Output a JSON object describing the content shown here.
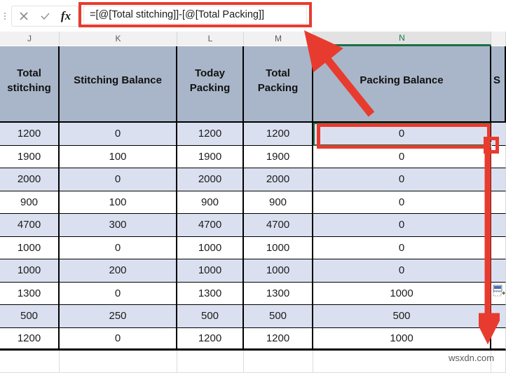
{
  "formula_bar": {
    "cancel_icon": "close-icon",
    "enter_icon": "check-icon",
    "fx_label": "fx",
    "formula": "=[@[Total stitching]]-[@[Total Packing]]",
    "placeholder": ""
  },
  "column_letters": [
    {
      "label": "J",
      "active": false
    },
    {
      "label": "K",
      "active": false
    },
    {
      "label": "L",
      "active": false
    },
    {
      "label": "M",
      "active": false
    },
    {
      "label": "N",
      "active": true
    },
    {
      "label": "",
      "active": false
    }
  ],
  "table": {
    "headers": [
      "Total stitching",
      "Stitching Balance",
      "Today Packing",
      "Total Packing",
      "Packing Balance",
      "S"
    ],
    "rows": [
      {
        "total_stitching": "1200",
        "stitching_balance": "0",
        "today_packing": "1200",
        "total_packing": "1200",
        "packing_balance": "0"
      },
      {
        "total_stitching": "1900",
        "stitching_balance": "100",
        "today_packing": "1900",
        "total_packing": "1900",
        "packing_balance": "0"
      },
      {
        "total_stitching": "2000",
        "stitching_balance": "0",
        "today_packing": "2000",
        "total_packing": "2000",
        "packing_balance": "0"
      },
      {
        "total_stitching": "900",
        "stitching_balance": "100",
        "today_packing": "900",
        "total_packing": "900",
        "packing_balance": "0"
      },
      {
        "total_stitching": "4700",
        "stitching_balance": "300",
        "today_packing": "4700",
        "total_packing": "4700",
        "packing_balance": "0"
      },
      {
        "total_stitching": "1000",
        "stitching_balance": "0",
        "today_packing": "1000",
        "total_packing": "1000",
        "packing_balance": "0"
      },
      {
        "total_stitching": "1000",
        "stitching_balance": "200",
        "today_packing": "1000",
        "total_packing": "1000",
        "packing_balance": "0"
      },
      {
        "total_stitching": "1300",
        "stitching_balance": "0",
        "today_packing": "1300",
        "total_packing": "1300",
        "packing_balance": "1000"
      },
      {
        "total_stitching": "500",
        "stitching_balance": "250",
        "today_packing": "500",
        "total_packing": "500",
        "packing_balance": "500"
      },
      {
        "total_stitching": "1200",
        "stitching_balance": "0",
        "today_packing": "1200",
        "total_packing": "1200",
        "packing_balance": "1000"
      }
    ]
  },
  "annotations": {
    "formula_box_color": "#e83b2f",
    "cell_box_color": "#e83b2f",
    "arrow_color": "#e83b2f",
    "selection_color": "#1d7044"
  },
  "autofill": {
    "icon": "autofill-options-icon"
  },
  "watermark": {
    "text": "wsxdn.com"
  }
}
